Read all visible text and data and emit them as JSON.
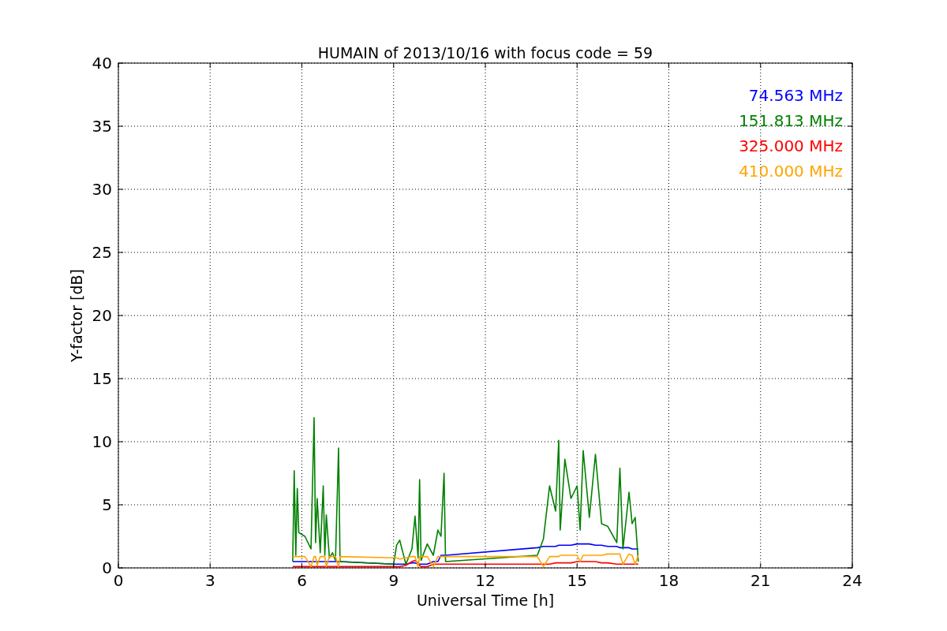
{
  "figure": {
    "chart_data": {
      "type": "line",
      "title": "HUMAIN of 2013/10/16 with focus code = 59",
      "xlabel": "Universal Time [h]",
      "ylabel": "Y-factor [dB]",
      "xlim": [
        0,
        24
      ],
      "ylim": [
        0,
        40
      ],
      "xticks": [
        0,
        3,
        6,
        9,
        12,
        15,
        18,
        21,
        24
      ],
      "yticks": [
        0,
        5,
        10,
        15,
        20,
        25,
        30,
        35,
        40
      ],
      "grid": true,
      "x": [
        5.7,
        5.75,
        5.8,
        5.85,
        5.9,
        6.1,
        6.3,
        6.4,
        6.45,
        6.5,
        6.6,
        6.7,
        6.75,
        6.8,
        6.9,
        7.0,
        7.1,
        7.2,
        7.25,
        9.0,
        9.1,
        9.2,
        9.4,
        9.6,
        9.7,
        9.8,
        9.85,
        9.9,
        10.1,
        10.3,
        10.45,
        10.55,
        10.65,
        10.7,
        13.7,
        13.9,
        14.1,
        14.3,
        14.4,
        14.45,
        14.6,
        14.8,
        15.0,
        15.1,
        15.2,
        15.4,
        15.6,
        15.8,
        16.0,
        16.3,
        16.4,
        16.5,
        16.7,
        16.8,
        16.9,
        17.0
      ],
      "series": [
        {
          "name": "74.563 MHz",
          "color": "#0000ff",
          "values": [
            0.5,
            0.5,
            0.5,
            0.5,
            0.5,
            0.5,
            0.5,
            0.5,
            0.5,
            0.5,
            0.5,
            0.5,
            0.5,
            0.5,
            0.5,
            0.5,
            0.5,
            0.5,
            0.5,
            0.3,
            0.3,
            0.3,
            0.3,
            0.4,
            0.4,
            0.3,
            0.3,
            0.3,
            0.3,
            0.5,
            0.5,
            1.0,
            1.0,
            1.0,
            1.6,
            1.7,
            1.7,
            1.7,
            1.8,
            1.8,
            1.8,
            1.8,
            1.9,
            1.9,
            1.9,
            1.9,
            1.8,
            1.8,
            1.7,
            1.7,
            1.6,
            1.6,
            1.6,
            1.5,
            1.5,
            1.5
          ]
        },
        {
          "name": "151.813 MHz",
          "color": "#008000",
          "values": [
            0.5,
            7.7,
            1.0,
            6.3,
            2.8,
            2.5,
            1.5,
            11.9,
            2.0,
            5.5,
            1.2,
            6.5,
            1.0,
            4.2,
            0.8,
            1.2,
            0.6,
            9.5,
            0.5,
            0.3,
            1.8,
            2.2,
            0.3,
            1.5,
            4.1,
            0.8,
            7.0,
            0.6,
            1.9,
            1.0,
            3.0,
            2.5,
            7.5,
            0.5,
            1.0,
            2.3,
            6.5,
            4.5,
            10.1,
            3.0,
            8.6,
            5.5,
            6.5,
            3.0,
            9.3,
            4.0,
            9.0,
            3.5,
            3.3,
            2.0,
            7.9,
            1.5,
            6.0,
            3.5,
            4.0,
            0.5
          ]
        },
        {
          "name": "325.000 MHz",
          "color": "#ff0000",
          "values": [
            0.1,
            0.1,
            0.1,
            0.1,
            0.1,
            0.1,
            0.1,
            0.1,
            0.1,
            0.1,
            0.1,
            0.1,
            0.1,
            0.1,
            0.1,
            0.1,
            0.1,
            0.1,
            0.1,
            0.1,
            0.1,
            0.1,
            0.2,
            0.5,
            0.6,
            0.4,
            0.2,
            0.1,
            0.1,
            0.3,
            0.3,
            0.3,
            0.3,
            0.3,
            0.3,
            0.3,
            0.3,
            0.4,
            0.4,
            0.4,
            0.4,
            0.4,
            0.5,
            0.5,
            0.5,
            0.5,
            0.5,
            0.4,
            0.4,
            0.3,
            0.3,
            0.3,
            0.3,
            0.3,
            0.3,
            0.3
          ]
        },
        {
          "name": "410.000 MHz",
          "color": "#ffa500",
          "values": [
            0.9,
            0.9,
            0.9,
            0.9,
            0.9,
            0.9,
            0.1,
            0.9,
            0.9,
            0.2,
            0.9,
            0.9,
            0.9,
            0.1,
            0.9,
            0.9,
            0.9,
            0.1,
            0.9,
            0.8,
            0.8,
            0.7,
            0.8,
            0.9,
            0.9,
            0.1,
            0.9,
            0.9,
            0.9,
            0.1,
            0.9,
            0.9,
            0.9,
            0.9,
            0.9,
            0.1,
            0.9,
            0.9,
            0.9,
            1.0,
            1.0,
            1.0,
            1.0,
            0.5,
            1.0,
            1.0,
            1.0,
            1.0,
            1.1,
            1.1,
            1.1,
            0.3,
            1.1,
            1.0,
            0.3,
            1.0
          ]
        }
      ]
    }
  }
}
